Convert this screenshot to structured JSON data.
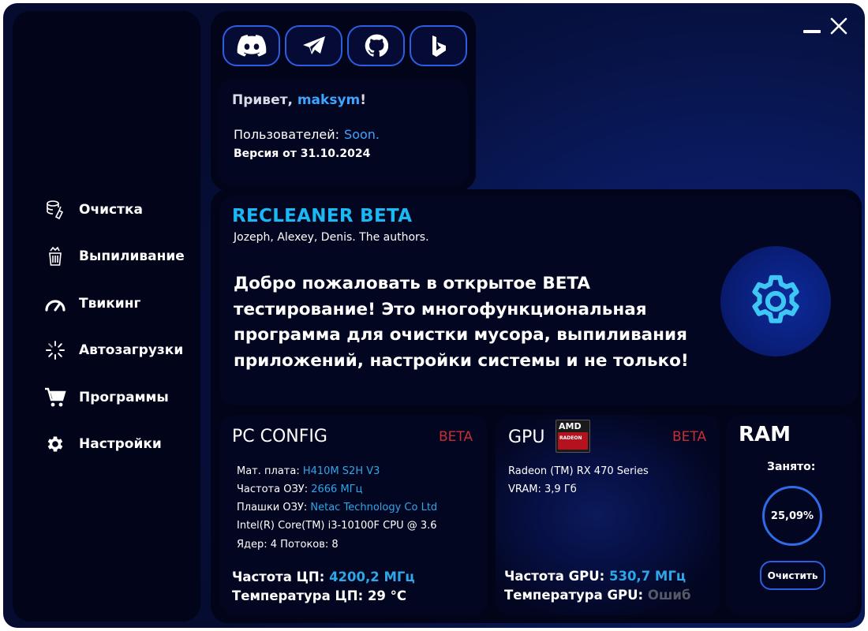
{
  "window_controls": {
    "minimize_icon": "minimize-icon",
    "close_icon": "close-icon"
  },
  "sidebar": {
    "items": [
      {
        "label": "Очистка",
        "icon": "database-broom-icon"
      },
      {
        "label": "Выпиливание",
        "icon": "trash-icon"
      },
      {
        "label": "Твикинг",
        "icon": "speedometer-icon"
      },
      {
        "label": "Автозагрузки",
        "icon": "loading-spinner-icon"
      },
      {
        "label": "Программы",
        "icon": "shopping-cart-icon"
      },
      {
        "label": "Настройки",
        "icon": "gear-icon"
      }
    ]
  },
  "social": {
    "buttons": [
      {
        "icon": "discord-icon"
      },
      {
        "icon": "telegram-icon"
      },
      {
        "icon": "github-icon"
      },
      {
        "icon": "bing-icon"
      }
    ]
  },
  "greeting": {
    "hello": "Привет,",
    "username": "maksym",
    "exclaim": "!",
    "users_label": "Пользователей:",
    "users_value": "Soon.",
    "version": "Версия от 31.10.2024"
  },
  "hero": {
    "title": "RECLEANER BETA",
    "authors": "Jozeph, Alexey, Denis. The authors.",
    "text": "Добро пожаловать в открытое BETA тестирование! Это многофункциональная программа для очистки мусора, выпиливания приложений, настройки системы и не только!"
  },
  "pc_config": {
    "title": "PC CONFIG",
    "beta": "BETA",
    "motherboard_label": "Мат. плата:",
    "motherboard_value": "H410M S2H V3",
    "ram_freq_label": "Частота ОЗУ:",
    "ram_freq_value": "2666 МГц",
    "ram_sticks_label": "Плашки ОЗУ:",
    "ram_sticks_value": "Netac Technology Co Ltd",
    "cpu": "Intel(R) Core(TM) i3-10100F CPU @ 3.6",
    "cores": "Ядер: 4 Потоков: 8",
    "cpu_freq_label": "Частота ЦП:",
    "cpu_freq_value": "4200,2 МГц",
    "cpu_temp_label": "Температура ЦП:",
    "cpu_temp_value": "29 °C"
  },
  "gpu": {
    "title": "GPU",
    "beta": "BETA",
    "badge_brand": "AMD",
    "badge_sub": "RADEON",
    "name": "Radeon (TM) RX 470 Series",
    "vram": "VRAM: 3,9 Гб",
    "freq_label": "Частота GPU:",
    "freq_value": "530,7 МГц",
    "temp_label": "Температура GPU:",
    "temp_value": "Ошиб"
  },
  "ram": {
    "title": "RAM",
    "busy_label": "Занято:",
    "busy_value": "25,09%",
    "clear_button": "Очистить"
  },
  "colors": {
    "accent": "#1ab8f5",
    "link_blue": "#3da4ff",
    "value_blue": "#2fa6e8",
    "beta_red": "#c62e36",
    "border_blue": "#2d5de0",
    "panel": "#02041a"
  }
}
